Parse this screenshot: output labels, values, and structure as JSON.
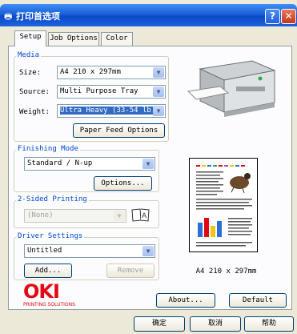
{
  "window": {
    "title": "打印首选项",
    "help_label": "?",
    "close_label": "✕"
  },
  "tabs": [
    {
      "label": "Setup",
      "active": true
    },
    {
      "label": "Job Options",
      "active": false
    },
    {
      "label": "Color",
      "active": false
    }
  ],
  "media": {
    "legend": "Media",
    "size_label": "Size:",
    "size_value": "A4 210 x 297mm",
    "source_label": "Source:",
    "source_value": "Multi Purpose Tray",
    "weight_label": "Weight:",
    "weight_value": "Ultra Heavy (33-54 lb.",
    "paper_feed_button": "Paper Feed Options"
  },
  "finishing": {
    "legend": "Finishing Mode",
    "value": "Standard / N-up",
    "options_button": "Options..."
  },
  "two_sided": {
    "legend": "2-Sided Printing",
    "value": "(None)"
  },
  "driver_settings": {
    "legend": "Driver Settings",
    "value": "Untitled",
    "add_button": "Add...",
    "remove_button": "Remove"
  },
  "preview": {
    "paper_size": "A4 210 x 297mm"
  },
  "logo": {
    "brand": "OKI",
    "tagline": "PRINTING SOLUTIONS",
    "color": "#e30613"
  },
  "buttons": {
    "about": "About...",
    "default": "Default",
    "ok": "确定",
    "cancel": "取消",
    "help": "帮助"
  },
  "colors": {
    "titlebar": "#0a48c8",
    "accent_legend": "#0046d5",
    "selection": "#316ac5"
  }
}
